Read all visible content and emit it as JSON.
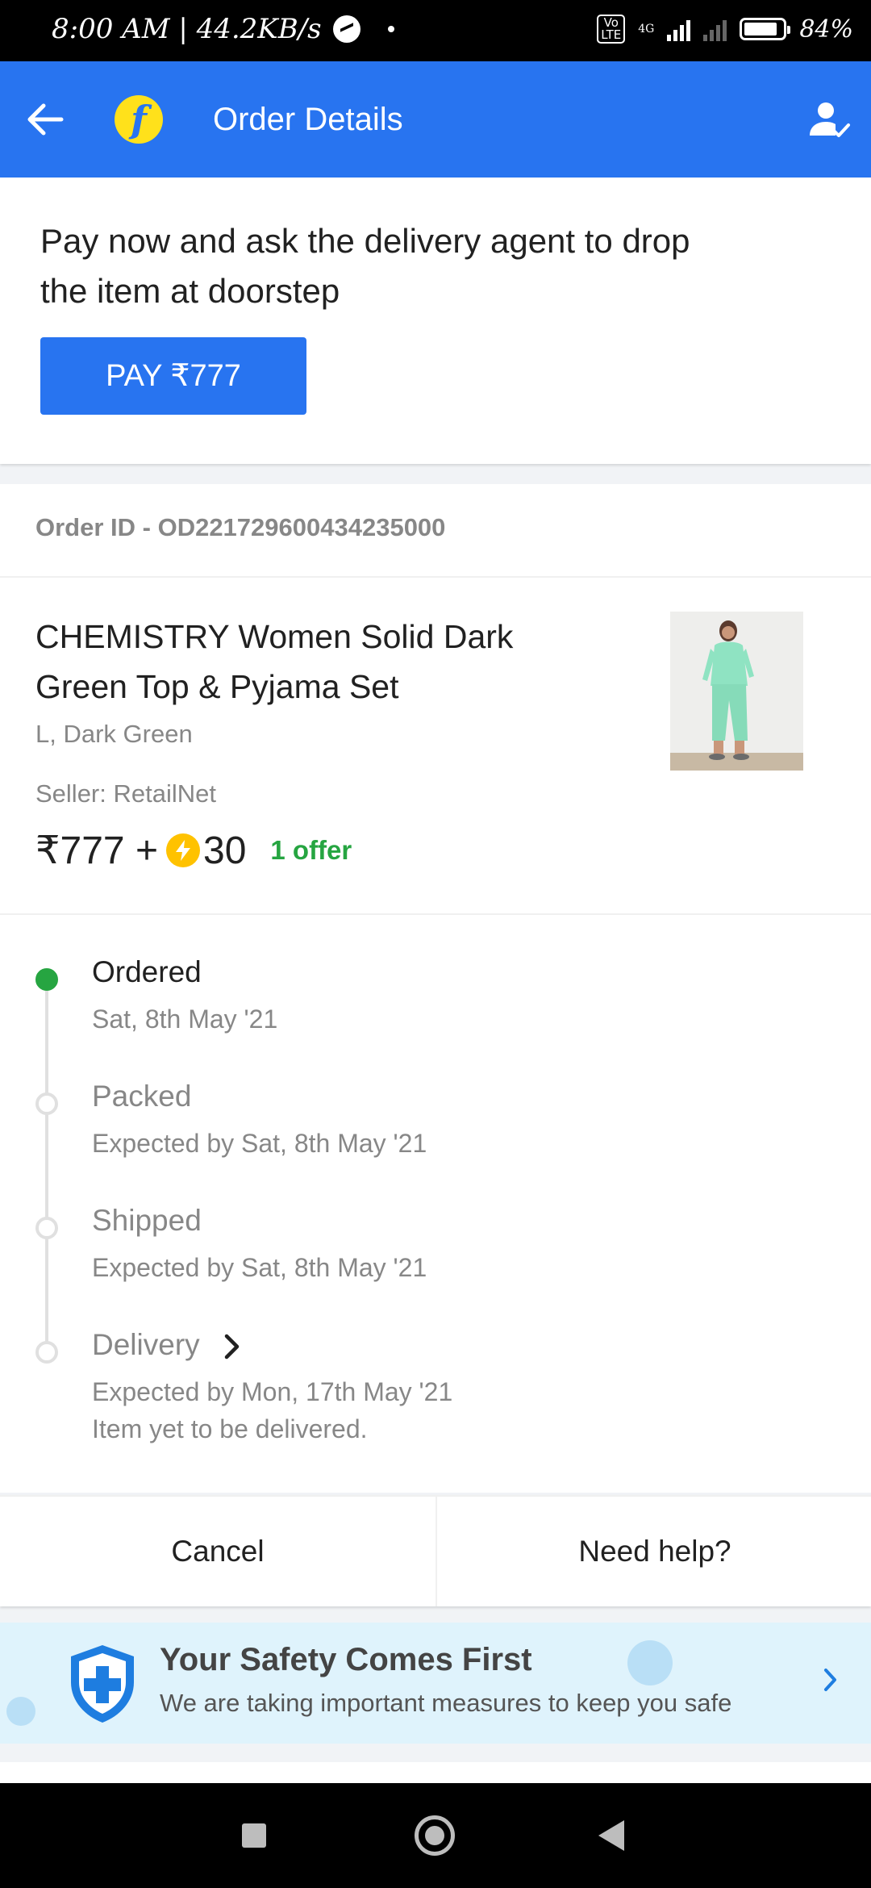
{
  "status_bar": {
    "time": "8:00 AM | 44.2KB/s",
    "volte": "Vo\nLTE",
    "network": "4G",
    "battery": "84%"
  },
  "header": {
    "title": "Order Details",
    "back_icon": "arrow-left-icon",
    "logo_letter": "f",
    "account_icon": "account-check-icon"
  },
  "pay_card": {
    "message": "Pay now and ask the delivery agent to drop the item at doorstep",
    "button_label": "PAY ₹777"
  },
  "order": {
    "id_text": "Order ID - OD221729600434235000",
    "product": {
      "name": "CHEMISTRY Women Solid Dark Green Top & Pyjama Set",
      "variant": "L, Dark Green",
      "seller": "Seller: RetailNet",
      "price": "₹777 +",
      "coins": "30",
      "offer": "1 offer"
    }
  },
  "timeline": [
    {
      "title": "Ordered",
      "subtitle": "Sat, 8th May '21",
      "done": true
    },
    {
      "title": "Packed",
      "subtitle": "Expected by Sat, 8th May '21",
      "done": false
    },
    {
      "title": "Shipped",
      "subtitle": "Expected by Sat, 8th May '21",
      "done": false
    },
    {
      "title": "Delivery",
      "subtitle": "Expected by Mon, 17th May '21",
      "note": "Item yet to be delivered.",
      "done": false
    }
  ],
  "actions": {
    "cancel_label": "Cancel",
    "help_label": "Need help?"
  },
  "safety_banner": {
    "title": "Your Safety Comes First",
    "subtitle": "We are taking important measures to keep you safe"
  },
  "colors": {
    "brand_blue": "#2874f0",
    "success_green": "#26a541",
    "coin_yellow": "#ffc200"
  }
}
